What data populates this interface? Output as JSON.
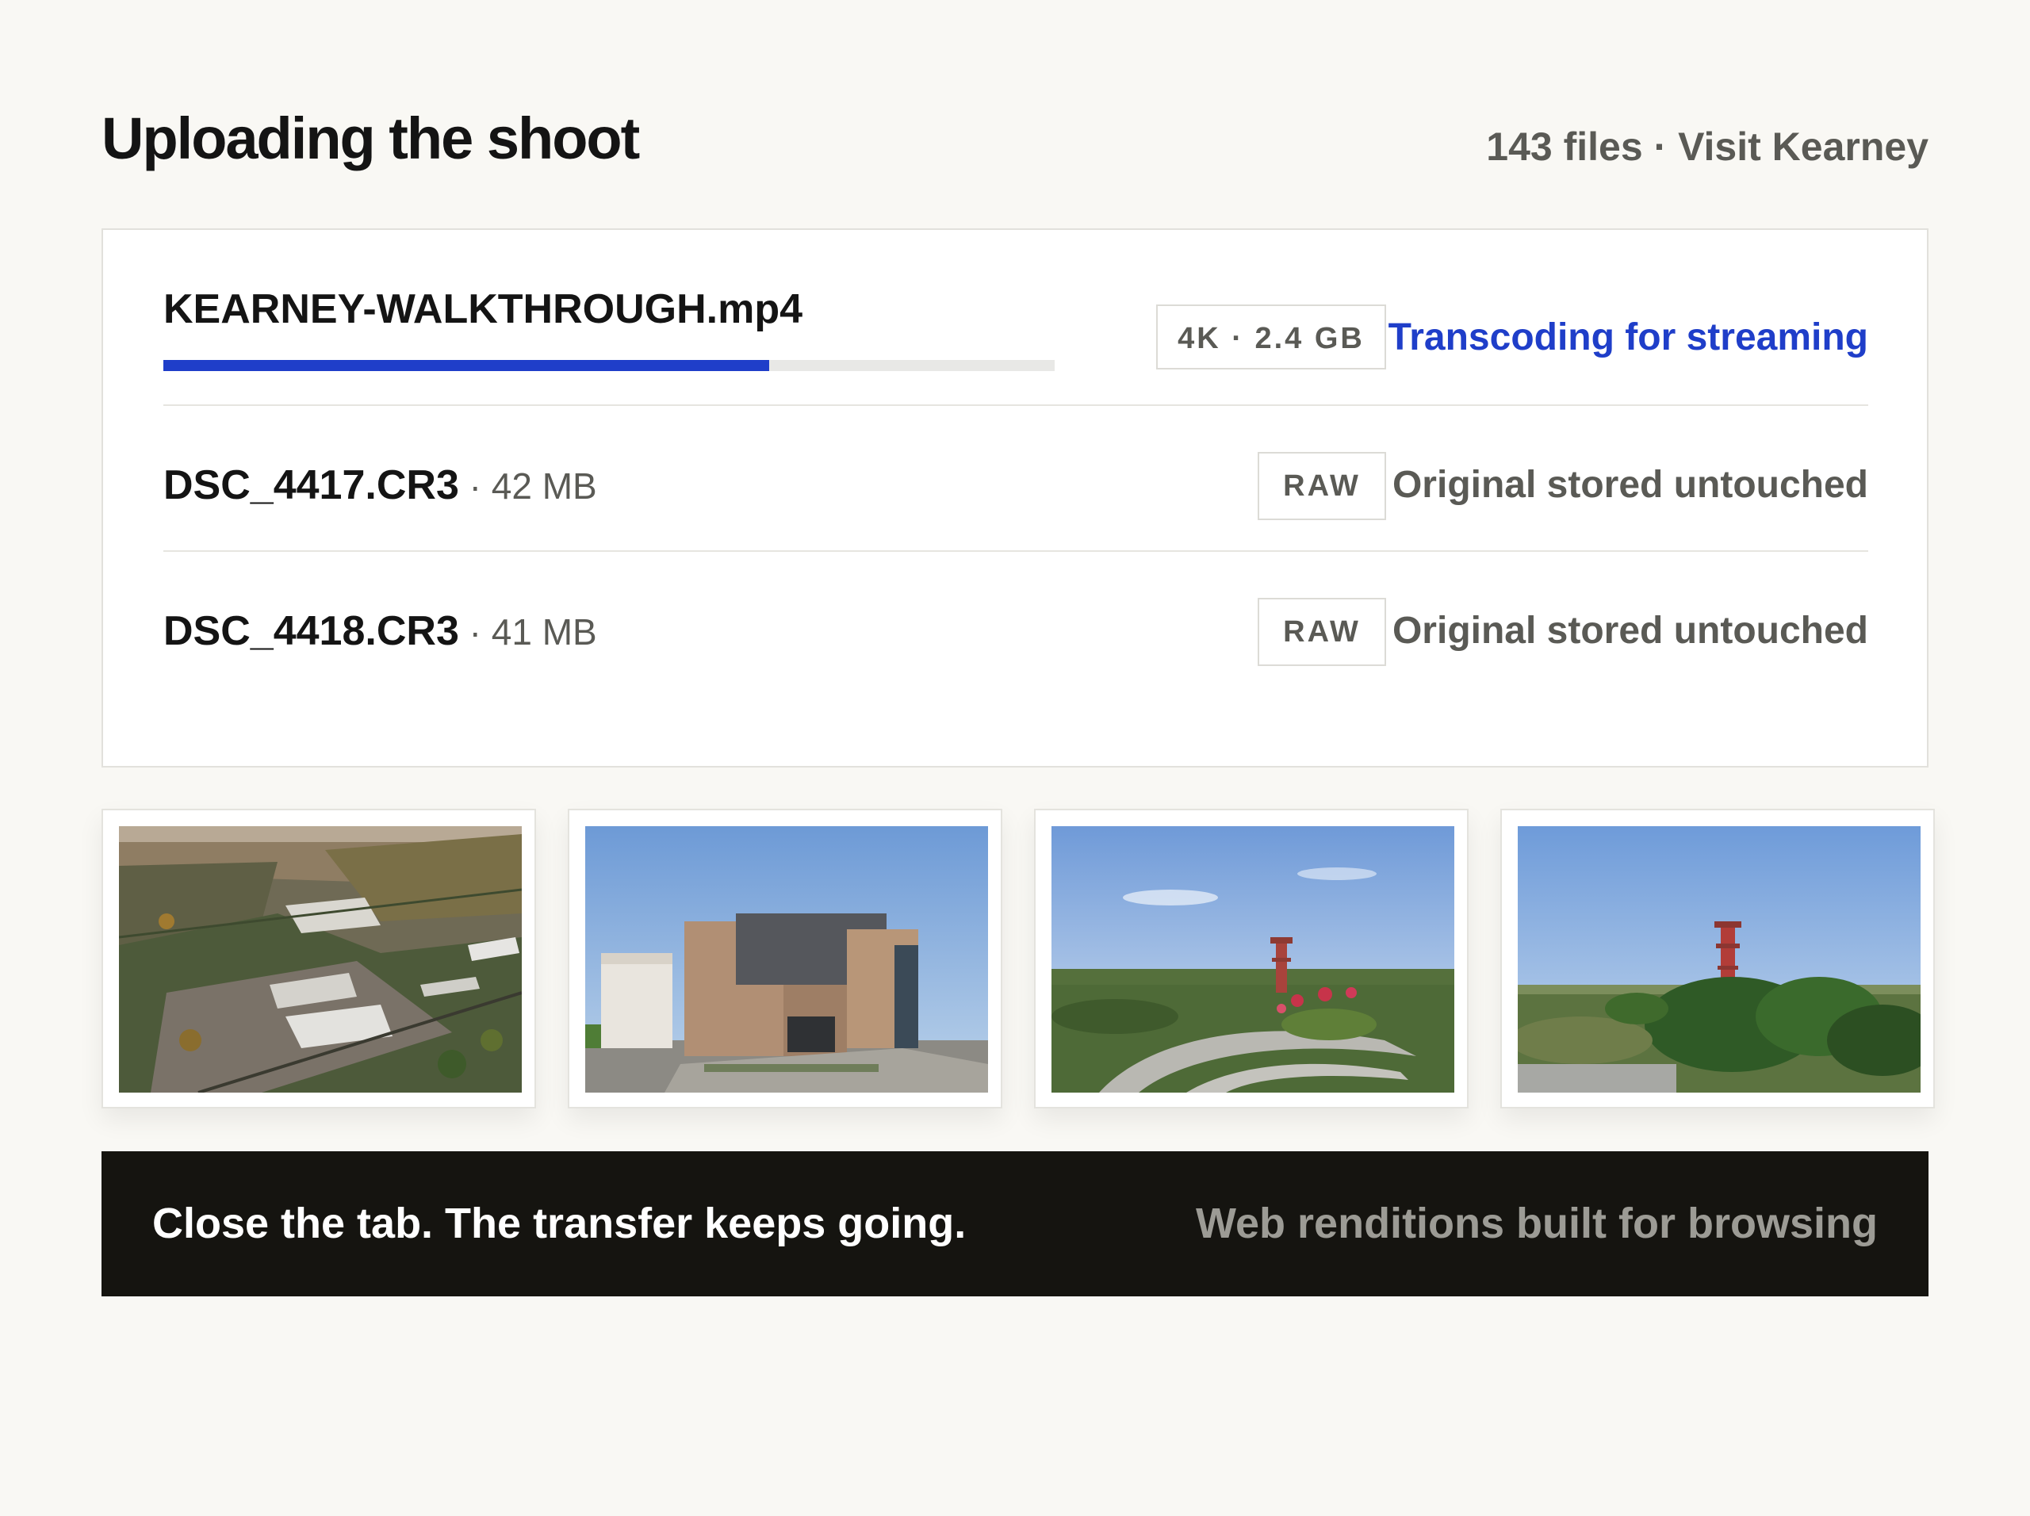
{
  "header": {
    "title": "Uploading the shoot",
    "meta": "143 files · Visit Kearney"
  },
  "files": [
    {
      "name": "KEARNEY-WALKTHROUGH.mp4",
      "size": "",
      "badge": "4K · 2.4 GB",
      "status": "Transcoding for streaming",
      "progress": 0.68
    },
    {
      "name": "DSC_4417.CR3",
      "size": " · 42 MB",
      "badge": "RAW",
      "status": "Original stored untouched"
    },
    {
      "name": "DSC_4418.CR3",
      "size": " · 41 MB",
      "badge": "RAW",
      "status": "Original stored untouched"
    }
  ],
  "thumbnails": [
    {
      "subject": "aerial-campus-photo"
    },
    {
      "subject": "modern-building-photo"
    },
    {
      "subject": "garden-tower-photo"
    },
    {
      "subject": "park-tower-photo"
    }
  ],
  "banner": {
    "left": "Close the tab. The transfer keeps going.",
    "right": "Web renditions built for browsing"
  },
  "colors": {
    "accent": "#1f3ec9",
    "background": "#f9f8f4",
    "banner": "#151410",
    "muted": "#5a5a55"
  }
}
